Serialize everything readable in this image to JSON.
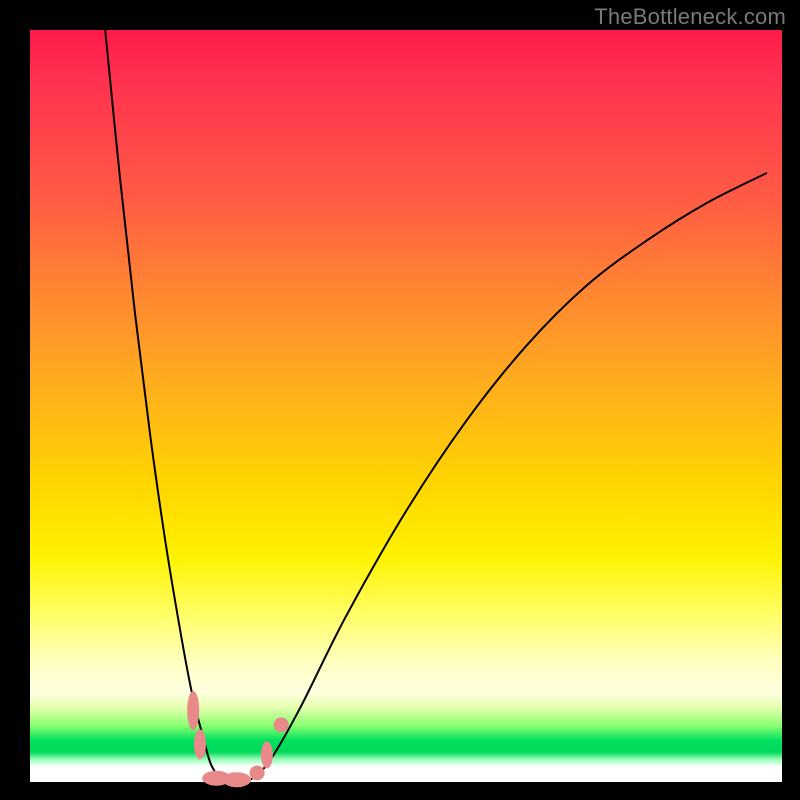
{
  "watermark": "TheBottleneck.com",
  "chart_data": {
    "type": "line",
    "title": "",
    "xlabel": "",
    "ylabel": "",
    "xlim": [
      0,
      100
    ],
    "ylim": [
      0,
      100
    ],
    "grid": false,
    "legend": false,
    "series": [
      {
        "name": "curve",
        "x": [
          10,
          12,
          14,
          16,
          18,
          20,
          21.5,
          23,
          24,
          25,
          25.8,
          28,
          29.6,
          32,
          36,
          42,
          50,
          58,
          66,
          74,
          82,
          90,
          98
        ],
        "values": [
          100,
          80,
          62,
          46,
          32,
          20,
          12,
          6,
          2.5,
          0.8,
          0,
          0,
          0.5,
          3,
          10,
          22,
          36,
          48,
          58,
          66,
          72,
          77,
          81
        ]
      }
    ],
    "markers": [
      {
        "shape": "pill",
        "x": 21.7,
        "y": 9.5,
        "rx": 0.8,
        "ry": 2.6
      },
      {
        "shape": "pill",
        "x": 22.6,
        "y": 5.0,
        "rx": 0.8,
        "ry": 2.0
      },
      {
        "shape": "pill",
        "x": 24.8,
        "y": 0.5,
        "rx": 1.9,
        "ry": 1.0
      },
      {
        "shape": "pill",
        "x": 27.5,
        "y": 0.3,
        "rx": 1.9,
        "ry": 1.0
      },
      {
        "shape": "dot",
        "x": 30.2,
        "y": 1.2,
        "r": 1.0
      },
      {
        "shape": "pill",
        "x": 31.5,
        "y": 3.6,
        "rx": 0.8,
        "ry": 1.8
      },
      {
        "shape": "dot",
        "x": 33.4,
        "y": 7.6,
        "r": 1.0
      }
    ],
    "colors": {
      "curve": "#000000",
      "marker": "#e88a8a",
      "gradient_stops": [
        "#ff1a4a",
        "#ff8a30",
        "#ffd400",
        "#ffff6a",
        "#00e060",
        "#ffffff"
      ]
    }
  }
}
